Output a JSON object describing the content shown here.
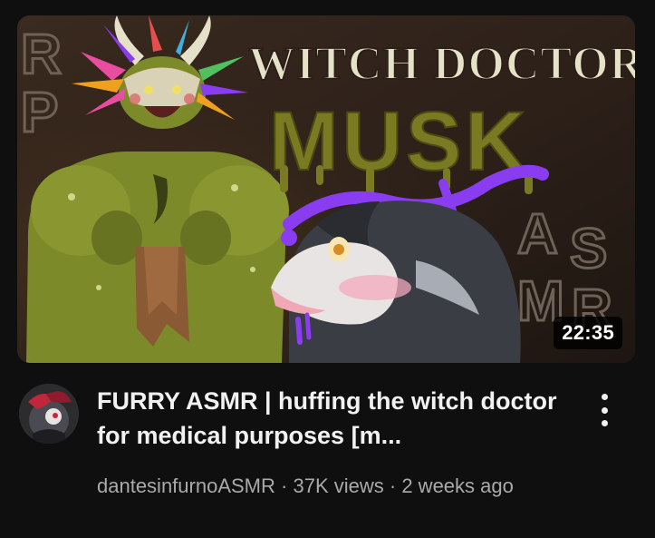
{
  "video": {
    "thumbnail_title_line1": "WITCH DOCTOR",
    "thumbnail_title_line2": "MUSK",
    "thumbnail_side_letters_left": "RP",
    "thumbnail_side_letters_right": "ASMR",
    "duration": "22:35",
    "title": "FURRY ASMR | huffing the witch doctor for medical purposes [m...",
    "channel": "dantesinfurnoASMR",
    "separator": "·",
    "views": "37K views",
    "age": "2 weeks ago"
  },
  "icons": {
    "more": "vertical-ellipsis-icon",
    "avatar": "channel-avatar"
  },
  "colors": {
    "background": "#0f0f0f",
    "title": "#f1f1f1",
    "meta": "#aaaaaa",
    "thumb_title": "#7a7a22",
    "accent_purple": "#8a3cf0"
  }
}
